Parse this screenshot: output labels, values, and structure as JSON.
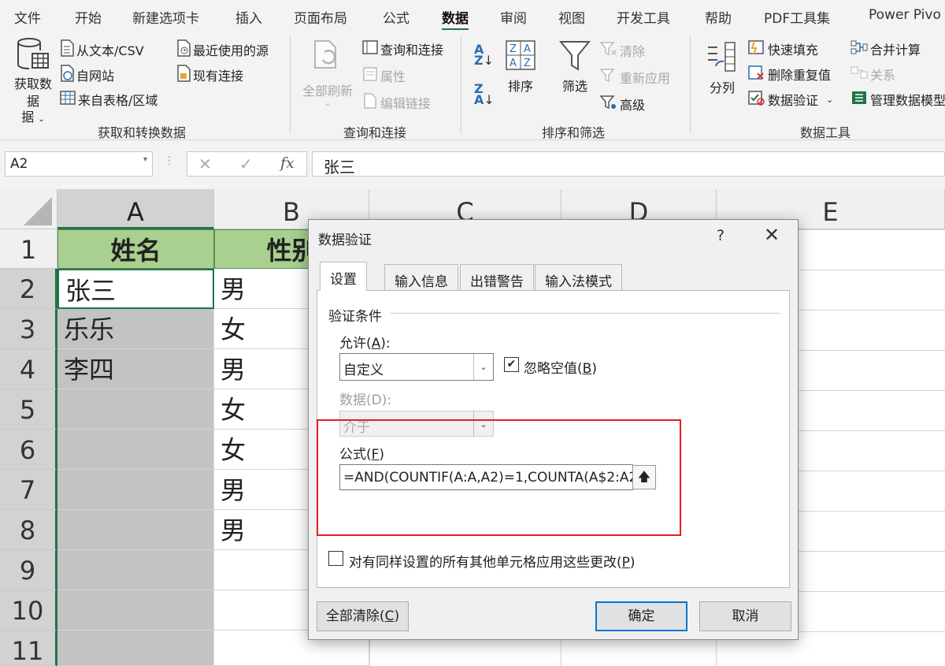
{
  "menu": [
    "文件",
    "开始",
    "新建选项卡",
    "插入",
    "页面布局",
    "公式",
    "数据",
    "审阅",
    "视图",
    "开发工具",
    "帮助",
    "PDF工具集",
    "Power Pivo"
  ],
  "ribbon": {
    "get_data": "获取数据",
    "get_data_sub": "据",
    "from_text": "从文本/CSV",
    "from_web": "自网站",
    "from_table": "来自表格/区域",
    "recent": "最近使用的源",
    "existing": "现有连接",
    "group1": "获取和转换数据",
    "refresh_all": "全部刷新",
    "queries": "查询和连接",
    "properties": "属性",
    "edit_links": "编辑链接",
    "group2": "查询和连接",
    "sort": "排序",
    "filter": "筛选",
    "clear": "清除",
    "reapply": "重新应用",
    "advanced": "高级",
    "group3": "排序和筛选",
    "text_to_columns": "分列",
    "flash_fill": "快速填充",
    "remove_dup": "删除重复值",
    "validation": "数据验证",
    "consolidate": "合并计算",
    "relations": "关系",
    "manage_model": "管理数据模型",
    "group4": "数据工具"
  },
  "formula_bar": {
    "name_box": "A2",
    "content": "张三"
  },
  "sheet": {
    "columns": [
      "A",
      "B",
      "C",
      "D",
      "E"
    ],
    "rows": [
      "1",
      "2",
      "3",
      "4",
      "5",
      "6",
      "7",
      "8",
      "9",
      "10",
      "11"
    ],
    "header_a": "姓名",
    "header_b": "性别",
    "col_a": [
      "张三",
      "乐乐",
      "李四"
    ],
    "col_b": [
      "男",
      "女",
      "男",
      "女",
      "女",
      "男",
      "男"
    ]
  },
  "dialog": {
    "title": "数据验证",
    "help": "?",
    "close": "✕",
    "tabs": [
      "设置",
      "输入信息",
      "出错警告",
      "输入法模式"
    ],
    "section": "验证条件",
    "allow_label": "允许(",
    "allow_key": "A",
    "allow_tail": "):",
    "allow_value": "自定义",
    "ignore_blank": "忽略空值(",
    "ignore_blank_key": "B",
    "data_label": "数据(D):",
    "data_value": "介于",
    "formula_label": "公式(",
    "formula_key": "F",
    "formula_value": "=AND(COUNTIF(A:A,A2)=1,COUNTA(A$2:A2",
    "apply_all": "对有同样设置的所有其他单元格应用这些更改(",
    "apply_all_key": "P",
    "clear_all": "全部清除(",
    "clear_all_key": "C",
    "ok": "确定",
    "cancel": "取消"
  },
  "colors": {
    "accent": "#217346",
    "header_fill": "#a9d08e",
    "highlight": "#e02020"
  }
}
